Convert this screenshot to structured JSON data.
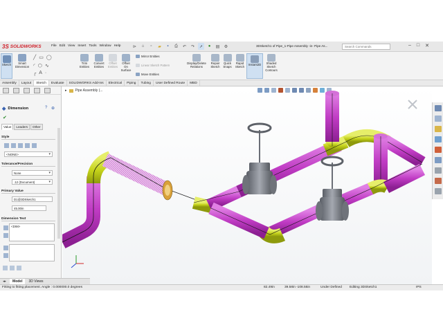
{
  "app": {
    "logo_text": "SOLIDWORKS",
    "logo_mark": "3S"
  },
  "menu": [
    "File",
    "Edit",
    "View",
    "Insert",
    "Tools",
    "Window",
    "Help"
  ],
  "document_title": "3DSketch1 of Pipe_1-Pipe Assembly -in- Pipe As...",
  "search_placeholder": "Search Commands",
  "ribbon": {
    "sketch": "Sketch",
    "smart_dimension": "Smart Dimension",
    "trim_entities": "Trim Entities",
    "convert_entities": "Convert Entities",
    "offset_entities": "Offset Entities",
    "offset_on_surface": "Offset On Surface",
    "mirror_entities": "Mirror Entities",
    "linear_sketch_pattern": "Linear Sketch Pattern",
    "move_entities": "Move Entities",
    "display_delete_relations": "Display/Delete Relations",
    "repair_sketch": "Repair Sketch",
    "quick_snaps": "Quick Snaps",
    "rapid_sketch": "Rapid Sketch",
    "instant2d": "Instant2D",
    "shaded_sketch_contours": "Shaded Sketch Contours"
  },
  "command_tabs": [
    "Assembly",
    "Layout",
    "Sketch",
    "Evaluate",
    "SOLIDWORKS Add-Ins",
    "Electrical",
    "Piping",
    "Tubing",
    "User Defined Route",
    "MBD"
  ],
  "active_command_tab": "Sketch",
  "tree_label": "Pipe Assembly (...",
  "property_manager": {
    "title": "Dimension",
    "tabs": [
      "Value",
      "Leaders",
      "Other"
    ],
    "style_label": "Style",
    "style_value": "<NONE>",
    "tolerance_label": "Tolerance/Precision",
    "tolerance_value": "None",
    "precision_value": ".12 (Document)",
    "primary_value_label": "Primary Value",
    "primary_ref": "D1@3DSketch1",
    "primary_value": "45.00in",
    "dimension_text_label": "Dimension Text",
    "dimension_text": "<DIM>"
  },
  "bottom_tabs": [
    "Model",
    "3D Views"
  ],
  "active_bottom_tab": "Model",
  "status": {
    "message": "Fitting to fitting placement. Angle : 0.000000.0 degrees",
    "x": "82.49in",
    "y": "39.58in -108.55in",
    "state": "Under Defined",
    "editing": "Editing 3DSketch1",
    "units": "IPS"
  },
  "colors": {
    "pipe": "#c03cc4",
    "fitting": "#c4d21a",
    "valve": "#7a7e86",
    "ribbon_bg": "#f3f3f3",
    "accent": "#d0202a"
  }
}
